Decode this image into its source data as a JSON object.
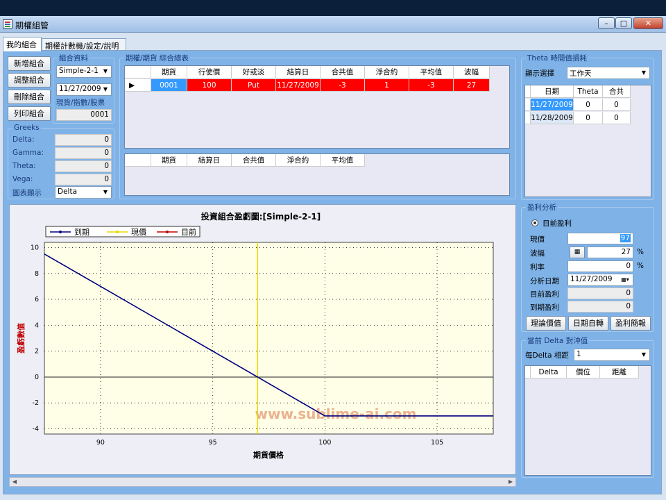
{
  "window": {
    "title": "期權組管"
  },
  "tabs": [
    {
      "label": "我的組合"
    },
    {
      "label": "期權計數機/設定/說明"
    }
  ],
  "buttons": {
    "add": "新增組合",
    "adjust": "調整組合",
    "delete": "刪除組合",
    "print": "列印組合"
  },
  "portfolio_group": {
    "label": "組合資料",
    "portfolio_select": "Simple-2-1",
    "date_select": "11/27/2009",
    "spot_label": "現貨/指數/股票",
    "spot_value": "0001"
  },
  "greeks": {
    "label": "Greeks",
    "rows": [
      {
        "name": "Delta:",
        "value": "0"
      },
      {
        "name": "Gamma:",
        "value": "0"
      },
      {
        "name": "Theta:",
        "value": "0"
      },
      {
        "name": "Vega:",
        "value": "0"
      }
    ],
    "chart_display_label": "圖表顯示",
    "chart_display_value": "Delta"
  },
  "summary": {
    "label": "期權/期貨 綜合總表",
    "headers": [
      "期貨",
      "行使價",
      "好或淡",
      "結算日",
      "合共值",
      "淨合約",
      "平均值",
      "波幅"
    ],
    "rows": [
      {
        "cells": [
          "0001",
          "100",
          "Put",
          "11/27/2009",
          "-3",
          "1",
          "-3",
          "27"
        ]
      }
    ],
    "lower_headers": [
      "期貨",
      "結算日",
      "合共值",
      "淨合約",
      "平均值"
    ]
  },
  "theta": {
    "label": "Theta 時間值損耗",
    "display_label": "顯示選擇",
    "display_value": "工作天",
    "headers": [
      "日期",
      "Theta",
      "合共"
    ],
    "rows": [
      {
        "date": "11/27/2009",
        "theta": "0",
        "total": "0"
      },
      {
        "date": "11/28/2009",
        "theta": "0",
        "total": "0"
      }
    ]
  },
  "profit": {
    "label": "盈利分析",
    "radio_label": "目前盈利",
    "spot_label": "現價",
    "spot_value": "97",
    "vol_label": "波幅",
    "vol_value": "27",
    "rate_label": "利率",
    "rate_value": "0",
    "date_label": "分析日期",
    "date_value": "11/27/2009",
    "current_label": "目前盈利",
    "current_value": "0",
    "expiry_label": "到期盈利",
    "expiry_value": "0",
    "percent": "%",
    "btn_theory": "理論價值",
    "btn_rotate": "日期自轉",
    "btn_brief": "盈利簡報"
  },
  "hedge": {
    "label": "當前 Delta 對沖值",
    "per_label": "每Delta 相距",
    "per_value": "1",
    "headers": [
      "Delta",
      "價位",
      "距離"
    ]
  },
  "colors": {
    "selected_row_bg": "#ff0000",
    "selected_first_cell_bg": "#3399ff",
    "expiry_line": "#000080",
    "spot_line": "#e8d800",
    "current_line": "#c00000",
    "plot_bg": "#ffffe8"
  },
  "chart_data": {
    "type": "line",
    "title": "投資組合盈虧圖:[Simple-2-1]",
    "xlabel": "期貨價格",
    "ylabel": "盈虧數值",
    "xlim": [
      87.5,
      107.5
    ],
    "ylim": [
      -4.4,
      10.4
    ],
    "xticks": [
      90,
      95,
      100,
      105
    ],
    "yticks": [
      -4,
      -2,
      0,
      2,
      4,
      6,
      8,
      10
    ],
    "grid": true,
    "legend": "top-left",
    "watermark": "www.sublime-ai.com",
    "spot_x": 97,
    "series": [
      {
        "name": "到期",
        "color": "#000080",
        "x": [
          87.5,
          100,
          107.5
        ],
        "y": [
          9.5,
          -3,
          -3
        ]
      },
      {
        "name": "現價",
        "color": "#e8d800"
      },
      {
        "name": "目前",
        "color": "#c00000"
      }
    ]
  }
}
